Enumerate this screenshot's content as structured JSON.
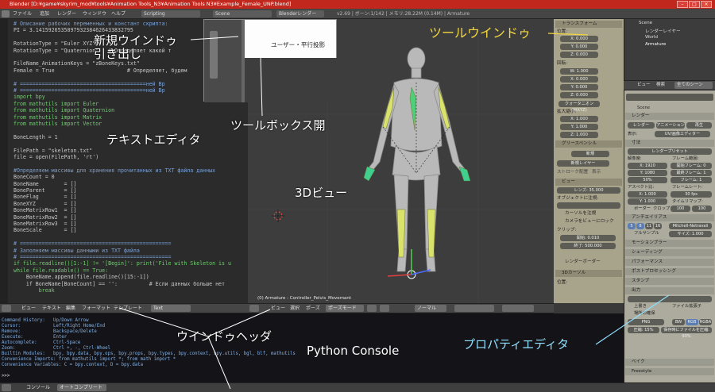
{
  "window": {
    "title": "Blender [D:¥game¥skyrim_mod¥tools¥Animation Tools_N3¥Animation Tools N3¥Example_Female_UNP.blend]",
    "controls": {
      "minimize": "–",
      "maximize": "□",
      "close": "×"
    }
  },
  "info_header": {
    "menus": [
      "ファイル",
      "追加",
      "レンダー",
      "ウィンドウ",
      "ヘルプ"
    ],
    "screen_layout": "Scripting",
    "scene": "Scene",
    "render_engine": "Blenderレンダー",
    "stats": "v2.69 | ボーン:1/142 | メモリ:28.22M (0.14M) | Armature"
  },
  "text_editor": {
    "lines": [
      {
        "t": "# Описание рабочих переменных и констант скрипта:",
        "c": "cm"
      },
      {
        "t": "PI = 3.1415926535897932384626433832795",
        "c": ""
      },
      {
        "t": "",
        "c": ""
      },
      {
        "t": "RotationType = \"Euler XYZ\"",
        "c": ""
      },
      {
        "t": "RotationType = \"Quaternion\"   # Определяет какой т",
        "c": ""
      },
      {
        "t": "",
        "c": ""
      },
      {
        "t": "FileName_AnimationKeys = \"zBoneKeys.txt\"",
        "c": ""
      },
      {
        "t": "Female = True                       # Определяет, будем",
        "c": ""
      },
      {
        "t": "",
        "c": ""
      },
      {
        "t": "# ========================================ней Вр",
        "c": "cm"
      },
      {
        "t": "# ========================================ней Вр",
        "c": "cm"
      },
      {
        "t": "import bpy",
        "c": "kw"
      },
      {
        "t": "from mathutils import Euler",
        "c": "kw"
      },
      {
        "t": "from mathutils import Quaternion",
        "c": "kw"
      },
      {
        "t": "from mathutils import Matrix",
        "c": "kw"
      },
      {
        "t": "from mathutils import Vector",
        "c": "kw"
      },
      {
        "t": "",
        "c": ""
      },
      {
        "t": "BoneLength = 1",
        "c": ""
      },
      {
        "t": "",
        "c": ""
      },
      {
        "t": "FilePath = \"skeleton.txt\"",
        "c": ""
      },
      {
        "t": "file = open(FilePath, 'rt')",
        "c": ""
      },
      {
        "t": "",
        "c": ""
      },
      {
        "t": "#Определяем массивы для хранения прочитанных из TXT файла данных",
        "c": "cm"
      },
      {
        "t": "BoneCount = 0",
        "c": ""
      },
      {
        "t": "BoneName        = []",
        "c": ""
      },
      {
        "t": "BoneParent      = []",
        "c": ""
      },
      {
        "t": "BoneFlag        = []",
        "c": ""
      },
      {
        "t": "BoneXYZ         = []",
        "c": ""
      },
      {
        "t": "BoneMatrixRow1  = []",
        "c": ""
      },
      {
        "t": "BoneMatrixRow2  = []",
        "c": ""
      },
      {
        "t": "BoneMatrixRow3  = []",
        "c": ""
      },
      {
        "t": "BoneScale       = []",
        "c": ""
      },
      {
        "t": "",
        "c": ""
      },
      {
        "t": "# ================================================",
        "c": "cm"
      },
      {
        "t": "# Заполняем массивы данными из TXT файла",
        "c": "cm"
      },
      {
        "t": "# ================================================",
        "c": "cm"
      },
      {
        "t": "if file.readline()[1:-1] != '[Begin]': print('File with Skeleton is u",
        "c": "kw"
      },
      {
        "t": "while file.readable() == True:",
        "c": "kw"
      },
      {
        "t": "    BoneName.append(file.readline()[15:-1])",
        "c": ""
      },
      {
        "t": "    if BoneName[BoneCount] == '':          # Если данных больше нет",
        "c": ""
      },
      {
        "t": "        break",
        "c": "kw"
      }
    ]
  },
  "text_header": {
    "items": [
      "ビュー",
      "テキスト",
      "編集",
      "フォーマット",
      "テンプレート"
    ],
    "file": "Text"
  },
  "viewport": {
    "view_label": "ユーザー・平行投影",
    "object_label": "(0) Armature : Controller_Pelvis_Movemant",
    "header_items": [
      "ビュー",
      "選択",
      "ポーズ"
    ],
    "mode": "ポーズモード",
    "pivot": "ノーマル"
  },
  "n_panel": {
    "transform_title": "トランスフォーム",
    "location_label": "位置:",
    "location": [
      "X: 0.000",
      "Y: 0.000",
      "Z: 0.000"
    ],
    "rotation_label": "回転:",
    "rotation": [
      "W: 1.000",
      "X: 0.000",
      "Y: 0.000",
      "Z: 0.000"
    ],
    "rotation_mode": "クォータニオン(WXYZ)",
    "scale_label": "拡大縮小:",
    "scale": [
      "X: 1.000",
      "Y: 1.000",
      "Z: 1.000"
    ],
    "grease_title": "グリースペンシル",
    "grease_new": "新規",
    "grease_new_layer": "新規レイヤー",
    "grease_left": "ストローク配置",
    "grease_right": "表示",
    "view_title": "ビュー",
    "lens": "レンズ: 35.000",
    "lock_to_object": "オブジェクトに注視:",
    "lock_cursor": "カーソルを注視",
    "lock_camera": "カメラをビューにロック",
    "clip_label": "クリップ:",
    "clip_start": "開始: 0.010",
    "clip_end": "終了: 500.000",
    "render_border": "レンダーボーダー",
    "cursor_title": "3Dカーソル",
    "cursor_label": "位置:"
  },
  "outliner": {
    "items": [
      "Scene",
      "レンダーレイヤー",
      "World",
      "Armature"
    ],
    "header": [
      "ビュー",
      "検索",
      "全てのシーン"
    ]
  },
  "properties": {
    "scene_label": "Scene",
    "render_title": "レンダー",
    "buttons": [
      "レンダー",
      "アニメーション",
      "再生"
    ],
    "display": "表示:",
    "display_value": "UV/画像エディター",
    "dimensions_title": "寸法",
    "preset": "レンダープリセット",
    "resolution": "解像度:",
    "res_x": "X: 1920",
    "res_y": "Y: 1080",
    "res_pct": "50%",
    "frame_range": "フレーム範囲:",
    "frame_start": "開始フレーム: 0",
    "frame_end": "最終フレーム: 1",
    "frame_step": "フレーム: 1",
    "aspect": "アスペクト比:",
    "asp_x": "X: 1.000",
    "asp_y": "Y: 1.000",
    "frame_rate": "フレームレート:",
    "fps": "30 fps",
    "time_remap": "タイムリマップ:",
    "remap_old": "100",
    "remap_new": "100",
    "border": "ボーダー",
    "crop": "クロップ",
    "aa_title": "アンチエイリアス",
    "aa_levels": [
      "5",
      "8",
      "11",
      "16"
    ],
    "aa_filter": "Mitchell-Netravali",
    "aa_full": "フルサンプル",
    "aa_size": "サイズ: 1.000",
    "sections": [
      "モーションブラー",
      "シェーディング",
      "パフォーマンス",
      "ポストプロセッシング",
      "スタンプ"
    ],
    "output_title": "出力",
    "overwrite": "上書き",
    "file_ext": "ファイル拡張子",
    "placeholders": "場所の確保",
    "format": "PNG",
    "bw": "BW",
    "rgb": "RGB",
    "rgba": "RGBA",
    "compression": "圧縮: 15%",
    "save_as_render": "保存時にファイルを圧縮: 90%",
    "bake": "ベイク",
    "freestyle": "Freestyle"
  },
  "console": {
    "lines": [
      "Command History:   Up/Down Arrow",
      "Cursor:            Left/Right Home/End",
      "Remove:            Backspace/Delete",
      "Execute:           Enter",
      "Autocomplete:      Ctrl-Space",
      "Zoom:              Ctrl +, -, Ctrl-Wheel",
      "Builtin Modules:   bpy, bpy.data, bpy.ops, bpy.props, bpy.types, bpy.context, bpy.utils, bgl, blf, mathutils",
      "Convenience Imports: from mathutils import *; from math import *",
      "Convenience Variables: C = bpy.context, D = bpy.data"
    ],
    "prompt": ">>> "
  },
  "console_header": {
    "items": [
      "コンソール",
      "オートコンプリート"
    ]
  },
  "annotations": {
    "new_window": "新規ウインドゥ",
    "pull_out": "引き出し",
    "tool_window": "ツールウインドゥ",
    "toolbox_open": "ツールボックス開",
    "text_editor": "テキストエディタ",
    "view3d": "3Dビュー",
    "window_header": "ウインドゥヘッダ",
    "python_console": "Python Console",
    "property_editor": "プロパティエディタ"
  },
  "colors": {
    "annotation_white": "#ffffff",
    "annotation_yellow": "#f1d63f",
    "annotation_cyan": "#8fe0ff",
    "titlebar": "#c2271d"
  }
}
